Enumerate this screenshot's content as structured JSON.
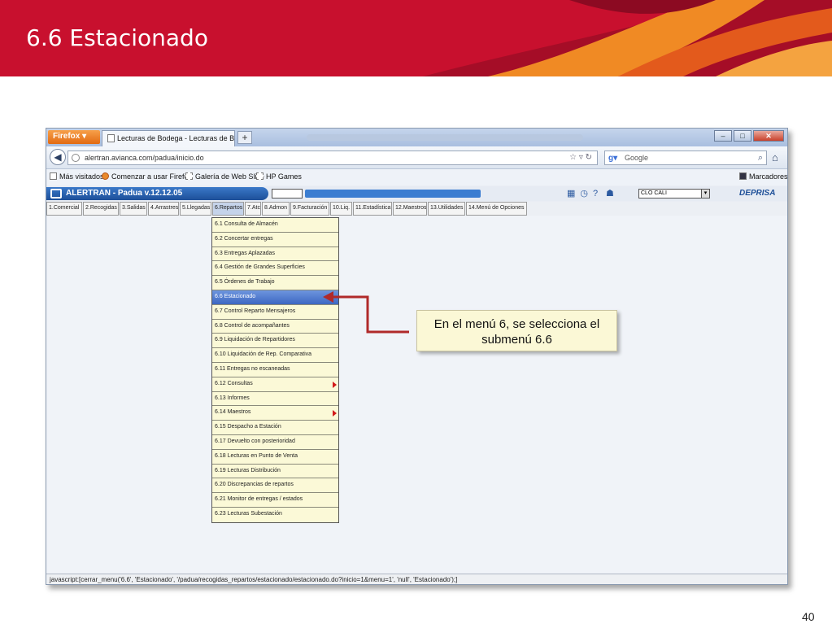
{
  "slide": {
    "title": "6.6 Estacionado",
    "page_number": "40",
    "callout_text": "En el menú 6, se selecciona el submenú 6.6",
    "colors": {
      "banner_red": "#c8102e",
      "banner_orange": "#f08a24",
      "callout_bg": "#fbf8d6",
      "arrow": "#b02a2a"
    }
  },
  "browser": {
    "firefox_button": "Firefox ▾",
    "tab_title": "Lecturas de Bodega - Lecturas de Bodega",
    "new_tab": "+",
    "url": "alertran.avianca.com/padua/inicio.do",
    "search_placeholder": "Google",
    "bookmarks": [
      {
        "label": "Más visitados",
        "icon": "bookmark-icon"
      },
      {
        "label": "Comenzar a usar Firefox",
        "icon": "firefox-icon"
      },
      {
        "label": "Galería de Web Slice",
        "icon": "web-slice-icon"
      },
      {
        "label": "HP Games",
        "icon": "web-slice-icon"
      }
    ],
    "bookmarks_menu": "Marcadores",
    "status_text": "javascript:[cerrar_menu('6.6', 'Estacionado', '/padua/recogidas_repartos/estacionado/estacionado.do?inicio=1&menu=1', 'null', 'Estacionado');]"
  },
  "app": {
    "title": "ALERTRAN - Padua  v.12.12.05",
    "city": "CLO CALI",
    "brand": "DEPRISA",
    "menu": [
      "1.Comercial",
      "2.Recogidas",
      "3.Salidas",
      "4.Arrastres",
      "5.Llegadas",
      "6.Repartos",
      "7.Atc",
      "8.Admon",
      "9.Facturación",
      "10.Liq.",
      "11.Estadística",
      "12.Maestros",
      "13.Utilidades",
      "14.Menú de Opciones"
    ],
    "submenu": [
      {
        "label": "6.1 Consulta de Almacén"
      },
      {
        "label": "6.2 Concertar entregas"
      },
      {
        "label": "6.3 Entregas Aplazadas"
      },
      {
        "label": "6.4 Gestión de Grandes Superficies"
      },
      {
        "label": "6.5 Órdenes de Trabajo"
      },
      {
        "label": "6.6 Estacionado",
        "selected": true
      },
      {
        "label": "6.7 Control Reparto Mensajeros"
      },
      {
        "label": "6.8 Control de acompañantes"
      },
      {
        "label": "6.9 Liquidación de Repartidores"
      },
      {
        "label": "6.10 Liquidación de Rep. Comparativa"
      },
      {
        "label": "6.11 Entregas no escaneadas"
      },
      {
        "label": "6.12 Consultas",
        "submenu": true
      },
      {
        "label": "6.13 Informes"
      },
      {
        "label": "6.14 Maestros",
        "submenu": true
      },
      {
        "label": "6.15 Despacho a Estación"
      },
      {
        "label": "6.17 Devuelto con posterioridad"
      },
      {
        "label": "6.18 Lecturas en Punto de Venta"
      },
      {
        "label": "6.19 Lecturas Distribución"
      },
      {
        "label": "6.20 Discrepancias de repartos"
      },
      {
        "label": "6.21 Monitor de entregas / estados"
      },
      {
        "label": "6.23 Lecturas Subestación"
      }
    ]
  }
}
